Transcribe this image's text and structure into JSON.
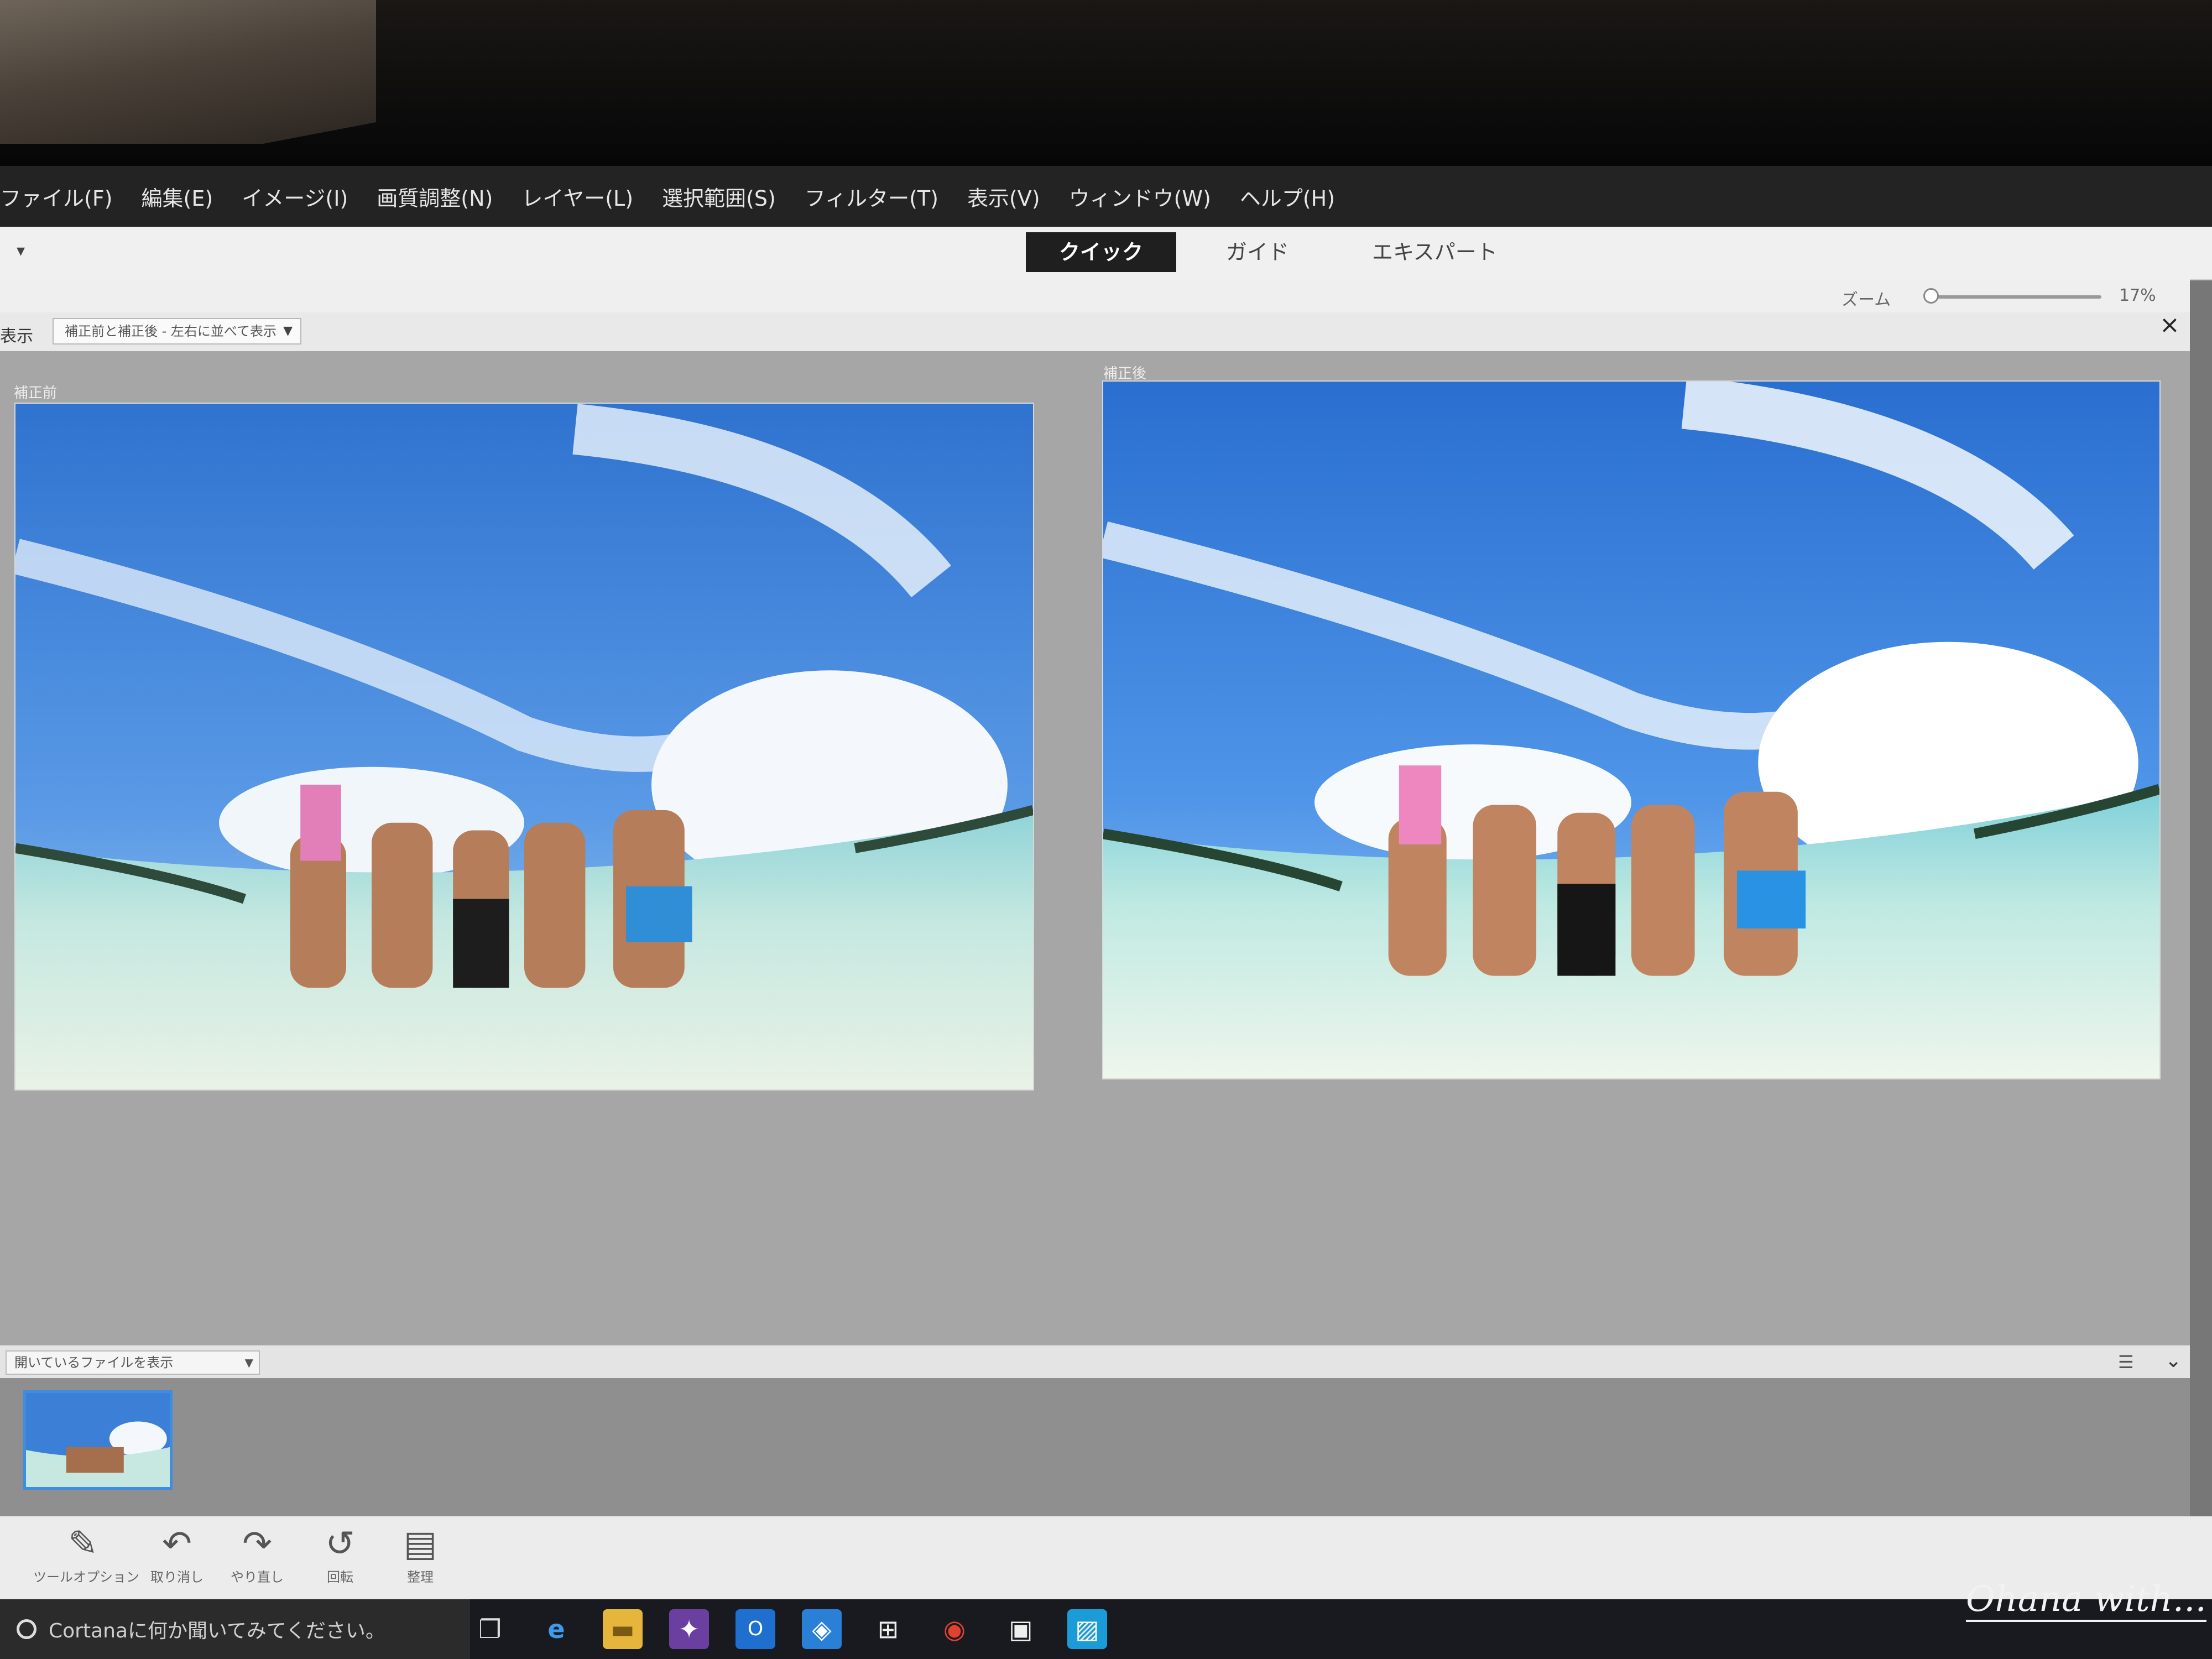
{
  "menu": [
    "ファイル(F)",
    "編集(E)",
    "イメージ(I)",
    "画質調整(N)",
    "レイヤー(L)",
    "選択範囲(S)",
    "フィルター(T)",
    "表示(V)",
    "ウィンドウ(W)",
    "ヘルプ(H)"
  ],
  "modes": [
    "クイック",
    "ガイド",
    "エキスパート"
  ],
  "zoom": {
    "label": "ズーム",
    "value": "17%",
    "level": 0.17
  },
  "view": {
    "label": "表示",
    "selected": "補正前と補正後 - 左右に並べて表示"
  },
  "panes": {
    "before_label": "補正前",
    "after_label": "補正後"
  },
  "filebin": {
    "selected": "開いているファイルを表示"
  },
  "bottom_tools": [
    {
      "icon": "pencil-icon",
      "label": "ツールオプション"
    },
    {
      "icon": "undo-icon",
      "label": "取り消し"
    },
    {
      "icon": "redo-icon",
      "label": "やり直し"
    },
    {
      "icon": "rotate-icon",
      "label": "回転"
    },
    {
      "icon": "organize-icon",
      "label": "整理"
    }
  ],
  "taskbar": {
    "cortana_placeholder": "Cortanaに何か聞いてみてください。"
  },
  "watermark": "Ohana with...",
  "colors": {
    "menubar": "#232323",
    "active_tab": "#1f1f1f",
    "canvas": "#a6a6a6",
    "selection": "#3d8de0"
  }
}
